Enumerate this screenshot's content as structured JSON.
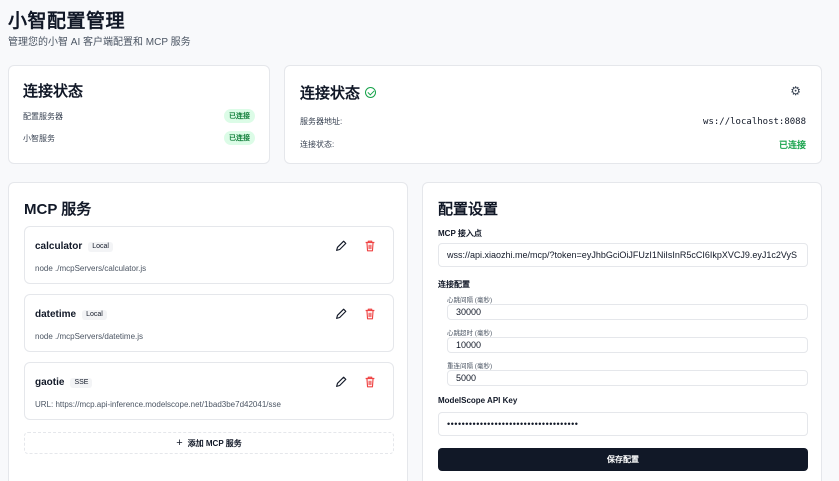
{
  "header": {
    "title": "小智配置管理",
    "subtitle": "管理您的小智 AI 客户端配置和 MCP 服务"
  },
  "status_left": {
    "title": "连接状态",
    "rows": [
      {
        "label": "配置服务器",
        "badge": "已连接"
      },
      {
        "label": "小智服务",
        "badge": "已连接"
      }
    ]
  },
  "status_right": {
    "title": "连接状态",
    "settings_icon": "gear-icon",
    "server_address_label": "服务器地址:",
    "server_address_value": "ws://localhost:8088",
    "connection_label": "连接状态:",
    "connection_value": "已连接"
  },
  "mcp": {
    "title": "MCP 服务",
    "services": [
      {
        "name": "calculator",
        "tag": "Local",
        "command": "node ./mcpServers/calculator.js"
      },
      {
        "name": "datetime",
        "tag": "Local",
        "command": "node ./mcpServers/datetime.js"
      },
      {
        "name": "gaotie",
        "tag": "SSE",
        "command": "URL: https://mcp.api-inference.modelscope.net/1bad3be7d42041/sse"
      }
    ],
    "add_label": "添加 MCP 服务"
  },
  "config": {
    "title": "配置设置",
    "endpoint_label": "MCP 接入点",
    "endpoint_value": "wss://api.xiaozhi.me/mcp/?token=eyJhbGciOiJFUzI1NiIsInR5cCI6IkpXVCJ9.eyJ1c2VyS",
    "connection_label": "连接配置",
    "heartbeat_interval_label": "心跳间隔 (毫秒)",
    "heartbeat_interval_value": "30000",
    "heartbeat_timeout_label": "心跳超时 (毫秒)",
    "heartbeat_timeout_value": "10000",
    "reconnect_interval_label": "重连间隔 (毫秒)",
    "reconnect_interval_value": "5000",
    "api_key_label": "ModelScope API Key",
    "api_key_value": "••••••••••••••••••••••••••••••••••••",
    "save_label": "保存配置"
  },
  "colors": {
    "success": "#16a34a",
    "danger": "#ef4444",
    "primary_button": "#111827"
  }
}
